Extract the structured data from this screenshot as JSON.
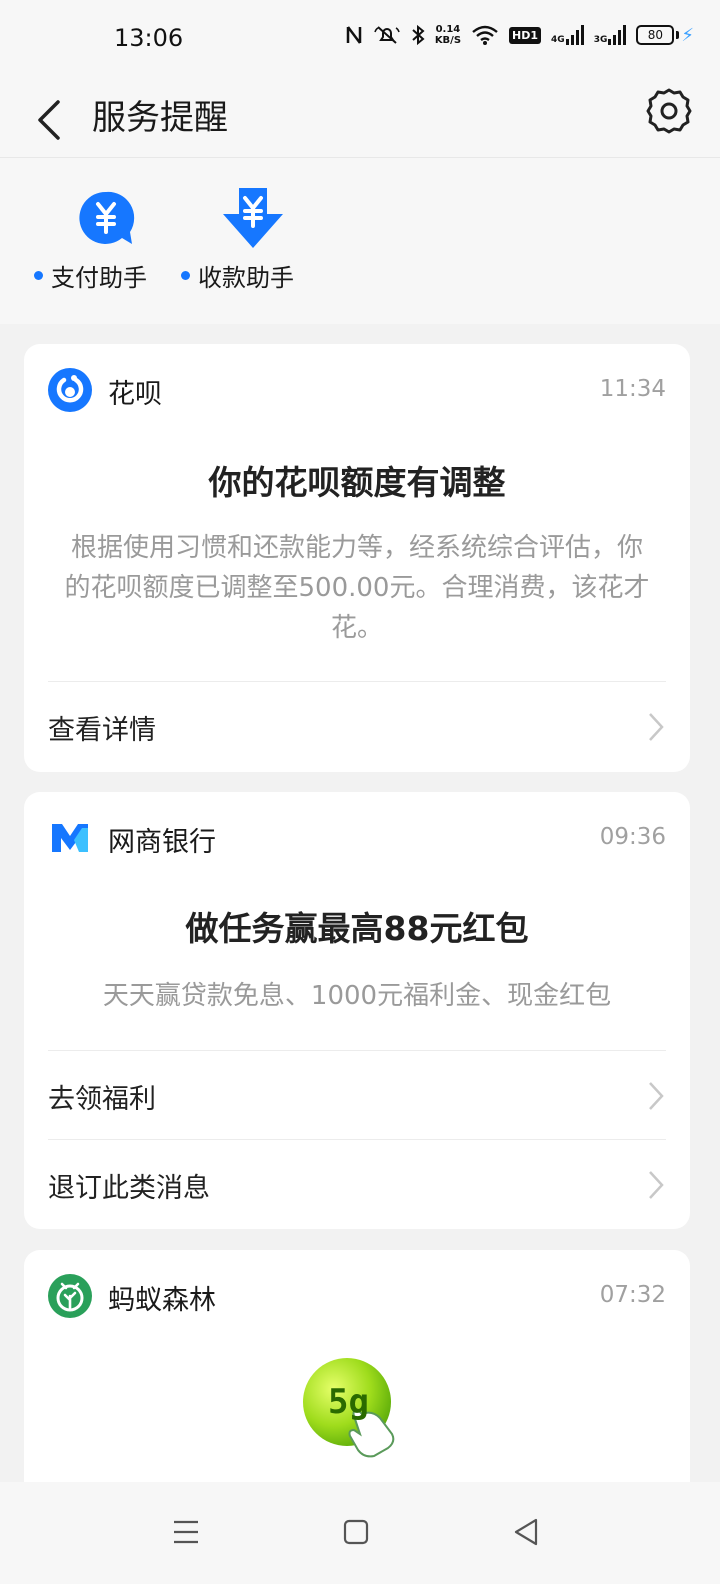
{
  "status_bar": {
    "time": "13:06",
    "net_speed_value": "0.14",
    "net_speed_unit": "KB/S",
    "hd_badge": "HD1",
    "sim1": "4G",
    "sim2": "3G",
    "battery": "80"
  },
  "header": {
    "title": "服务提醒",
    "back_icon": "chevron-left-icon",
    "settings_icon": "gear-icon"
  },
  "shortcuts": [
    {
      "label": "支付助手",
      "icon": "yuan-chat-bubble-icon"
    },
    {
      "label": "收款助手",
      "icon": "yuan-down-arrow-icon"
    }
  ],
  "cards": [
    {
      "app": "花呗",
      "time": "11:34",
      "title": "你的花呗额度有调整",
      "body": "根据使用习惯和还款能力等，经系统综合评估，你的花呗额度已调整至500.00元。合理消费，该花才花。",
      "rows": [
        "查看详情"
      ]
    },
    {
      "app": "网商银行",
      "time": "09:36",
      "title": "做任务赢最高88元红包",
      "body": "天天赢贷款免息、1000元福利金、现金红包",
      "rows": [
        "去领福利",
        "退订此类消息"
      ]
    },
    {
      "app": "蚂蚁森林",
      "time": "07:32",
      "energy_label": "5g"
    }
  ],
  "colors": {
    "accent": "#1677ff",
    "page_bg": "#f2f2f2",
    "card_bg": "#ffffff",
    "forest_green": "#2aa05a",
    "energy_ball": "#9fdc1c"
  }
}
